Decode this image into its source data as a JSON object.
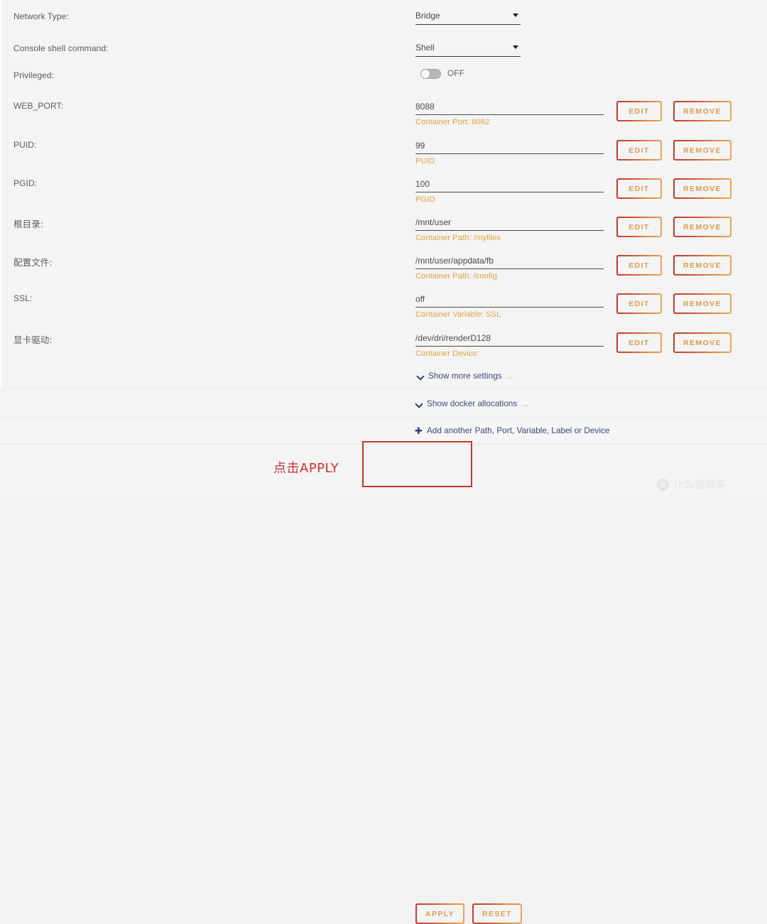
{
  "form": {
    "rows": [
      {
        "label": "Network Type:",
        "kind": "select",
        "value": "Bridge"
      },
      {
        "label": "Console shell command:",
        "kind": "select",
        "value": "Shell"
      },
      {
        "label": "Privileged:",
        "kind": "toggle",
        "value": "OFF",
        "state": "off"
      },
      {
        "label": "WEB_PORT:",
        "kind": "input",
        "value": "8088",
        "help": "Container Port: 8082",
        "edit": "EDIT",
        "remove": "REMOVE"
      },
      {
        "label": "PUID:",
        "kind": "input",
        "value": "99",
        "help": "PUID",
        "edit": "EDIT",
        "remove": "REMOVE"
      },
      {
        "label": "PGID:",
        "kind": "input",
        "value": "100",
        "help": "PGID",
        "edit": "EDIT",
        "remove": "REMOVE"
      },
      {
        "label": "根目录:",
        "cjk": true,
        "kind": "input",
        "value": "/mnt/user",
        "help": "Container Path: /myfiles",
        "edit": "EDIT",
        "remove": "REMOVE"
      },
      {
        "label": "配置文件:",
        "cjk": true,
        "kind": "input",
        "value": "/mnt/user/appdata/fb",
        "help": "Container Path: /config",
        "edit": "EDIT",
        "remove": "REMOVE"
      },
      {
        "label": "SSL:",
        "kind": "input",
        "value": "off",
        "help": "Container Variable: SSL",
        "edit": "EDIT",
        "remove": "REMOVE"
      },
      {
        "label": "显卡驱动:",
        "cjk": true,
        "kind": "input",
        "value": "/dev/dri/renderD128",
        "help": "Container Device:",
        "edit": "EDIT",
        "remove": "REMOVE"
      }
    ]
  },
  "links": {
    "show_more_settings": "Show more settings",
    "show_docker_allocations": "Show docker allocations",
    "ellipsis": "...",
    "add_another": "Add another Path, Port, Variable, Label or Device"
  },
  "actions": {
    "apply": "APPLY",
    "reset": "RESET"
  },
  "annotation": {
    "text": "点击APPLY"
  },
  "watermark": {
    "logo": "值",
    "text": "什么值得买"
  }
}
